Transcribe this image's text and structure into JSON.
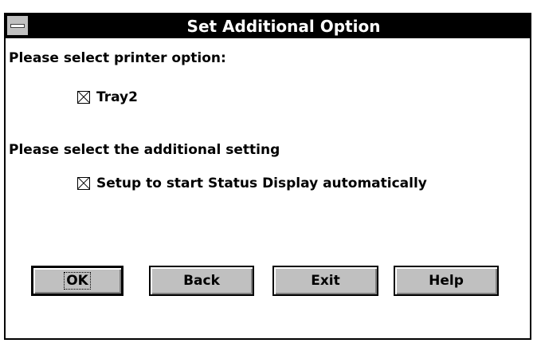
{
  "window": {
    "title": "Set Additional Option"
  },
  "sections": {
    "printer_prompt": "Please select printer option:",
    "tray_label": "Tray2",
    "tray_checked": true,
    "additional_prompt": "Please select the additional setting",
    "status_label": "Setup to start Status Display automatically",
    "status_checked": true
  },
  "buttons": {
    "ok": "OK",
    "back": "Back",
    "exit": "Exit",
    "help": "Help"
  }
}
